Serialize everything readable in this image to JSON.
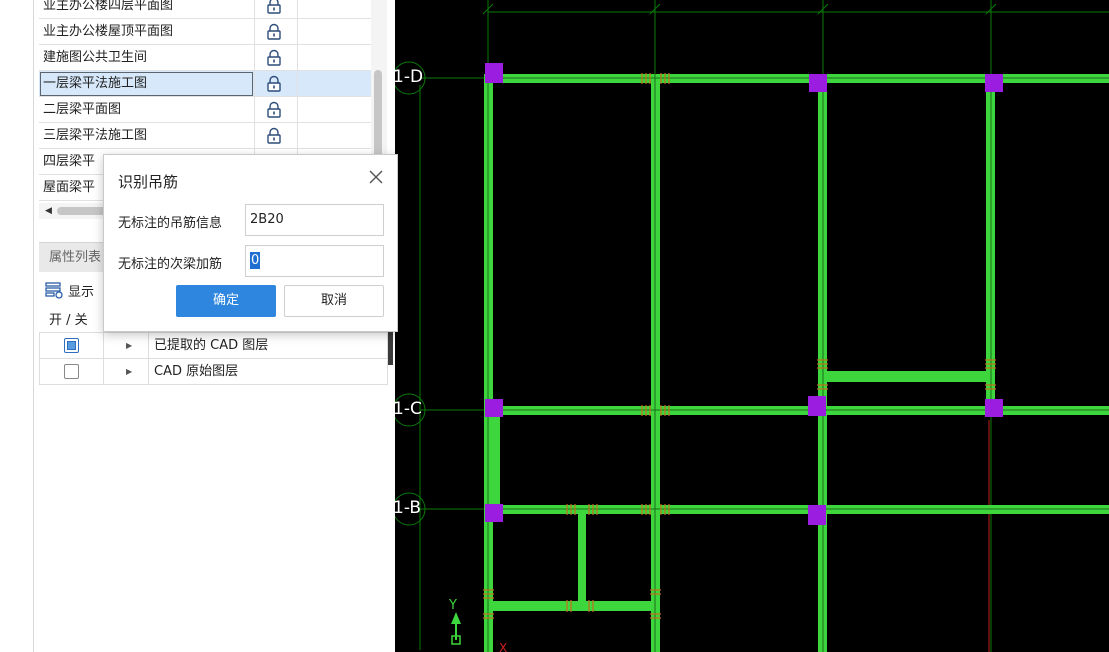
{
  "drawing_list": {
    "items": [
      {
        "label": "业主办公楼四层平面图",
        "selected": false
      },
      {
        "label": "业主办公楼屋顶平面图",
        "selected": false
      },
      {
        "label": "建施图公共卫生间",
        "selected": false
      },
      {
        "label": "一层梁平法施工图",
        "selected": true
      },
      {
        "label": "二层梁平面图",
        "selected": false
      },
      {
        "label": "三层梁平法施工图",
        "selected": false
      },
      {
        "label": "四层梁平",
        "selected": false
      },
      {
        "label": "屋面梁平",
        "selected": false
      }
    ],
    "lock_icon": "lock-icon"
  },
  "properties": {
    "title": "属性列表",
    "display_label": "显示",
    "layer_header": "开 / 关",
    "layers": [
      {
        "name": "已提取的 CAD 图层",
        "checked": true
      },
      {
        "name": "CAD 原始图层",
        "checked": false
      }
    ]
  },
  "dialog": {
    "title": "识别吊筋",
    "field1_label": "无标注的吊筋信息",
    "field1_value": "2B20",
    "field2_label": "无标注的次梁加筋",
    "field2_value": "0",
    "ok_label": "确定",
    "cancel_label": "取消",
    "accent_color": "#2e86de"
  },
  "cad": {
    "axis_labels": [
      "1-D",
      "1-C",
      "1-B"
    ],
    "ucs_x": "X",
    "ucs_y": "Y",
    "beam_color": "#3dd63d",
    "column_color": "#9b1ee0",
    "grid_color": "#0a7a0a",
    "background": "#000000"
  }
}
